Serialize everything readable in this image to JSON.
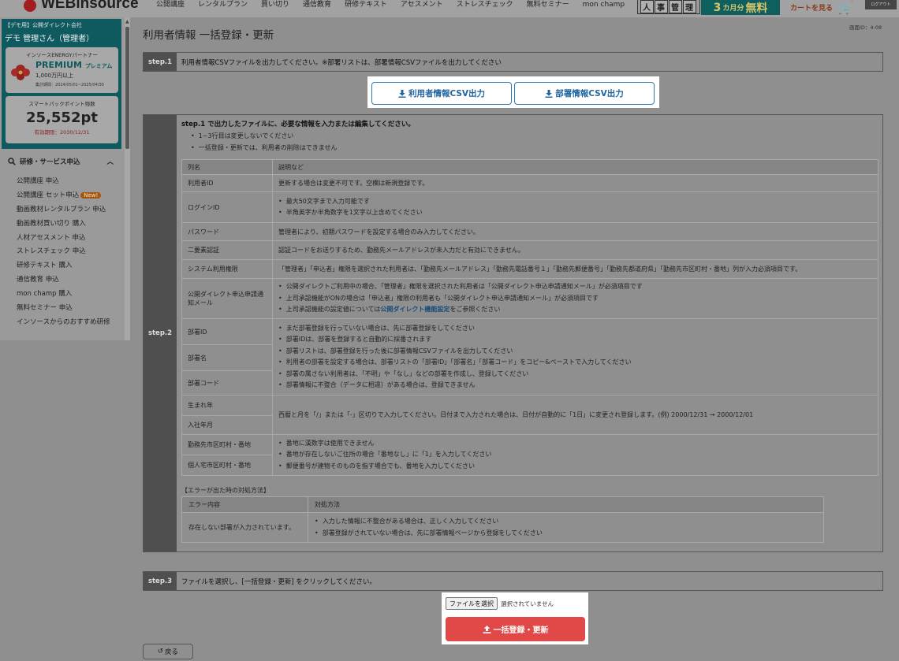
{
  "header": {
    "logo_text": "WEBinsource",
    "nav": [
      "公開講座",
      "レンタルプラン",
      "買い切り",
      "通信教育",
      "研修テキスト",
      "アセスメント",
      "ストレスチェック",
      "無料セミナー",
      "mon champ"
    ],
    "hr_badge": [
      "人",
      "事",
      "管",
      "理"
    ],
    "promo_big": "3",
    "promo_small": "カ月分",
    "promo_text": "無料",
    "cart_label": "カートを見る",
    "logout_label": "ログアウト"
  },
  "sidebar": {
    "company": "【デモ用】公開ダイレクト会社",
    "user": "デモ 管理さん（管理者）",
    "partner": "インソースENERGYパートナー",
    "premium": "PREMIUM",
    "premium_kana": "プレミアム",
    "premium_amount": "1,000万円以上",
    "premium_period": "集計期間：2024/05/01~2025/04/30",
    "points_label": "スマートパックポイント残数",
    "points_value": "25,552pt",
    "points_expiry": "有効期限：2030/12/31",
    "service_header": "研修・サービス申込",
    "items": [
      {
        "label": "公開講座 申込"
      },
      {
        "label": "公開講座 セット申込",
        "badge": "New!"
      },
      {
        "label": "動画教材レンタルプラン 申込"
      },
      {
        "label": "動画教材買い切り 購入"
      },
      {
        "label": "人材アセスメント 申込"
      },
      {
        "label": "ストレスチェック 申込"
      },
      {
        "label": "研修テキスト 購入"
      },
      {
        "label": "通信教育 申込"
      },
      {
        "label": "mon champ 購入"
      },
      {
        "label": "無料セミナー 申込"
      },
      {
        "label": "インソースからのおすすめ研修"
      }
    ]
  },
  "page": {
    "screen_id": "画面ID：4-08",
    "title": "利用者情報 一括登録・更新"
  },
  "step1": {
    "label": "step.1",
    "text": "利用者情報CSVファイルを出力してください。※部署リストは、部署情報CSVファイルを出力してください",
    "btn_user": "利用者情報CSV出力",
    "btn_dept": "部署情報CSV出力"
  },
  "step2": {
    "label": "step.2",
    "intro": "step.1 で出力したファイルに、必要な情報を入力または編集してください。",
    "notes": [
      "1~3行目は変更しないでください",
      "一括登録・更新では、利用者の削除はできません"
    ],
    "col_header_name": "列名",
    "col_header_desc": "説明など",
    "rows": {
      "userid": {
        "name": "利用者ID",
        "desc": "更新する場合は変更不可です。空欄は新規登録です。"
      },
      "loginid": {
        "name": "ログインID",
        "desc": [
          "最大50文字まで入力可能です",
          "半角英字か半角数字を1文字以上含めてください"
        ]
      },
      "password": {
        "name": "パスワード",
        "desc": "管理者により、初期パスワードを設定する場合のみ入力してください。"
      },
      "twofa": {
        "name": "二要素認証",
        "desc": "認証コードをお送りするため、勤務先メールアドレスが未入力だと有効にできません。"
      },
      "sysauth": {
        "name": "システム利用権限",
        "desc": "「管理者」「申込者」権限を選択された利用者は、「勤務先メールアドレス」「勤務先電話番号１」「勤務先郵便番号」「勤務先都道府県」「勤務先市区町村・番地」列が入力必須項目です。"
      },
      "direct": {
        "name": "公開ダイレクト申込申請通知メール",
        "desc": [
          "公開ダイレクトご利用中の場合、「管理者」権限を選択された利用者は「公開ダイレクト申込申請通知メール」が必須項目です",
          "上司承認機能がONの場合は「申込者」権限の利用者も「公開ダイレクト申込申請通知メール」が必須項目です"
        ],
        "desc3_pre": "上司承認機能の設定値については",
        "desc3_link": "公開ダイレクト機能設定",
        "desc3_post": "をご参照ください"
      },
      "dept": {
        "names": [
          "部署ID",
          "部署名",
          "部署コード"
        ],
        "desc": [
          "まだ部署登録を行っていない場合は、先に部署登録をしてください",
          "部署IDは、部署を登録すると自動的に採番されます",
          "部署リストは、部署登録を行った後に部署情報CSVファイルを出力してください",
          "利用者の部署を設定する場合は、部署リストの「部署ID」「部署名」「部署コード」をコピー&ペーストで入力してください",
          "部署の属さない利用者は、「不明」や「なし」などの部署を作成し、登録してください",
          "部署情報に不整合（データに相違）がある場合は、登録できません"
        ]
      },
      "dates": {
        "names": [
          "生まれ年",
          "入社年月"
        ],
        "desc": "西暦と月を「/」または「-」区切りで入力してください。日付まで入力された場合は、日付が自動的に「1日」に変更され登録します。(例) 2000/12/31 → 2000/12/01"
      },
      "address": {
        "names": [
          "勤務先市区町村・番地",
          "個人宅市区町村・番地"
        ],
        "desc": [
          "番地に漢数字は使用できません",
          "番地が存在しないご住所の場合「番地なし」に「1」を入力してください",
          "郵便番号が建物そのものを指す場合でも、番地を入力してください"
        ]
      }
    },
    "error_title": "【エラーが出た時の対処方法】",
    "error_header_content": "エラー内容",
    "error_header_action": "対処方法",
    "error_content": "存在しない部署が入力されています。",
    "error_actions": [
      "入力した情報に不整合がある場合は、正しく入力してください",
      "部署登録がされていない場合は、先に部署情報ページから登録をしてください"
    ]
  },
  "step3": {
    "label": "step.3",
    "text": "ファイルを選択し、[一括登録・更新] をクリックしてください。",
    "file_button": "ファイルを選択",
    "file_status": "選択されていません",
    "bulk_button": "一括登録・更新"
  },
  "back_button": "戻る",
  "colors": {
    "teal": "#0f5a5f",
    "accent_red": "#e14848",
    "link_blue": "#2065a0"
  }
}
